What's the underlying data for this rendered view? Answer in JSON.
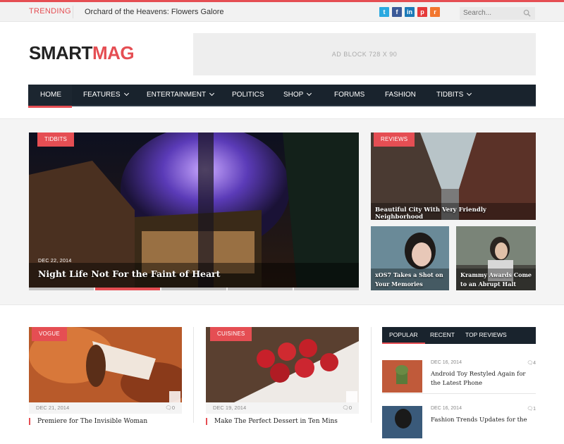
{
  "topbar": {
    "trending_label": "TRENDING",
    "trending_headline": "Orchard of the Heavens: Flowers Galore",
    "social": [
      {
        "icon": "twitter-icon",
        "glyph": "t",
        "color": "#2aa9e0"
      },
      {
        "icon": "facebook-icon",
        "glyph": "f",
        "color": "#3b5998"
      },
      {
        "icon": "linkedin-icon",
        "glyph": "in",
        "color": "#1d7ab8"
      },
      {
        "icon": "pinterest-icon",
        "glyph": "p",
        "color": "#e53a3a"
      },
      {
        "icon": "rss-icon",
        "glyph": "r",
        "color": "#f2762e"
      }
    ],
    "search_placeholder": "Search..."
  },
  "header": {
    "logo_part1": "SMART",
    "logo_part2": "MAG",
    "ad_text": "AD BLOCK  728 X 90"
  },
  "nav": {
    "items": [
      {
        "label": "HOME",
        "dropdown": false
      },
      {
        "label": "FEATURES",
        "dropdown": true
      },
      {
        "label": "ENTERTAINMENT",
        "dropdown": true
      },
      {
        "label": "POLITICS",
        "dropdown": false
      },
      {
        "label": "SHOP",
        "dropdown": true
      },
      {
        "label": "FORUMS",
        "dropdown": false
      },
      {
        "label": "FASHION",
        "dropdown": false
      },
      {
        "label": "TIDBITS",
        "dropdown": true
      }
    ]
  },
  "featured": {
    "main": {
      "category": "TIDBITS",
      "date": "DEC 22, 2014",
      "title": "Night Life Not For the Faint of Heart"
    },
    "right_top": {
      "category": "REVIEWS",
      "title": "Beautiful City With Very Friendly Neighborhood"
    },
    "right_bottom_left": {
      "title_line1": "xOS7 Takes a Shot on",
      "title_line2": "Your Memories"
    },
    "right_bottom_right": {
      "title_line1": "Krammy Awards Come",
      "title_line2": "to an Abrupt Halt"
    },
    "slider_active_index": 1
  },
  "posts": [
    {
      "category": "VOGUE",
      "date": "DEC 21, 2014",
      "comments": "0",
      "title": "Premiere for The Invisible Woman"
    },
    {
      "category": "CUISINES",
      "date": "DEC 19, 2014",
      "comments": "0",
      "title": "Make The Perfect Dessert in Ten Mins"
    }
  ],
  "sidebar": {
    "tabs": [
      "POPULAR",
      "RECENT",
      "TOP REVIEWS"
    ],
    "items": [
      {
        "date": "DEC 16, 2014",
        "comments": "4",
        "title": "Android Toy Restyled Again for the Latest Phone"
      },
      {
        "date": "DEC 16, 2014",
        "comments": "1",
        "title": "Fashion Trends Updates for the"
      }
    ]
  },
  "colors": {
    "accent": "#e54e53",
    "nav_bg": "#19232d"
  }
}
